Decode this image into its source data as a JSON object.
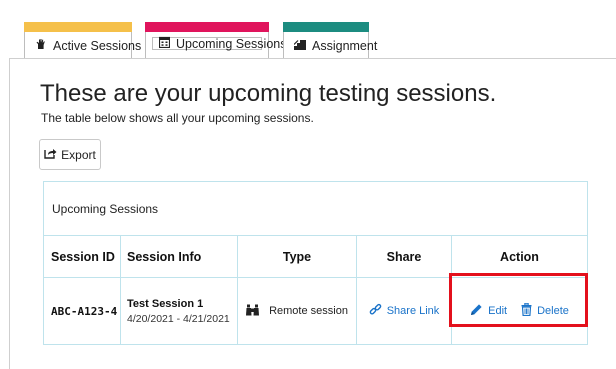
{
  "tabs": [
    {
      "label": "Active Sessions",
      "icon": "hand-icon",
      "color": "#f5c04a"
    },
    {
      "label": "Upcoming Sessions",
      "icon": "calendar-icon",
      "color": "#e0145c"
    },
    {
      "label": "Assignment",
      "icon": "stairs-icon",
      "color": "#1c8c80"
    }
  ],
  "main": {
    "title": "These are your upcoming testing sessions.",
    "subtitle": "The table below shows all your upcoming sessions.",
    "export_label": "Export"
  },
  "table": {
    "caption": "Upcoming Sessions",
    "columns": [
      "Session ID",
      "Session Info",
      "Type",
      "Share",
      "Action"
    ],
    "rows": [
      {
        "session_id": "ABC-A123-4",
        "session_name": "Test Session 1",
        "session_dates": "4/20/2021 - 4/21/2021",
        "type": "Remote session",
        "share": "Share Link",
        "edit": "Edit",
        "delete": "Delete"
      }
    ]
  },
  "colors": {
    "link": "#1a73c9",
    "highlight": "#e3101c",
    "table_border": "#bfe3ec"
  }
}
